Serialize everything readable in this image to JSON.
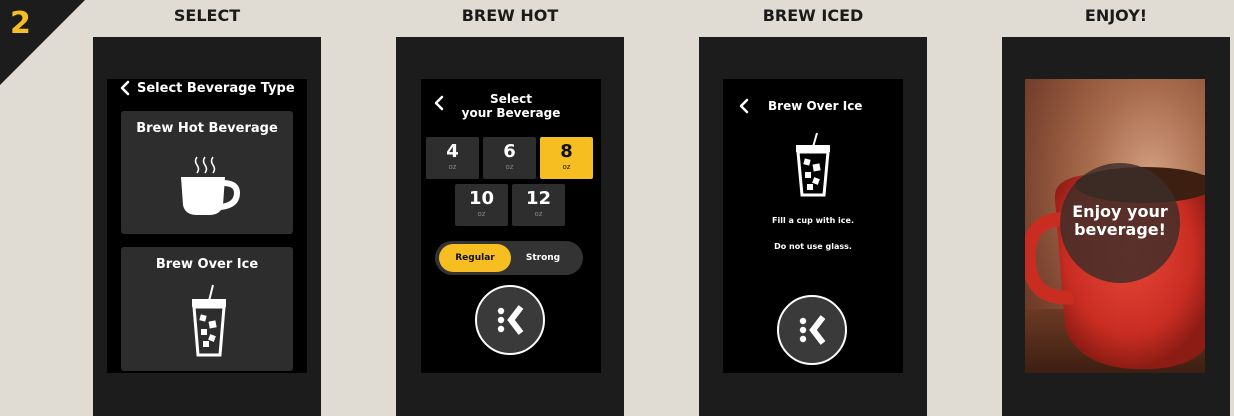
{
  "step": {
    "number": "2"
  },
  "columns": [
    {
      "title": "SELECT"
    },
    {
      "title": "BREW HOT"
    },
    {
      "title": "BREW ICED"
    },
    {
      "title": "ENJOY!"
    }
  ],
  "select": {
    "title": "Select Beverage Type",
    "back_icon": "chevron-left-icon",
    "options": [
      {
        "label": "Brew Hot Beverage",
        "icon": "hot-cup-icon"
      },
      {
        "label": "Brew Over Ice",
        "icon": "iced-cup-icon"
      }
    ]
  },
  "brew_hot": {
    "title_line1": "Select",
    "title_line2": "your Beverage",
    "sizes": [
      {
        "value": "4",
        "unit": "oz",
        "selected": false
      },
      {
        "value": "6",
        "unit": "oz",
        "selected": false
      },
      {
        "value": "8",
        "unit": "oz",
        "selected": true
      },
      {
        "value": "10",
        "unit": "oz",
        "selected": false
      },
      {
        "value": "12",
        "unit": "oz",
        "selected": false
      }
    ],
    "strength": {
      "regular": "Regular",
      "strong": "Strong",
      "selected": "Regular"
    },
    "brew_icon": "keurig-k-icon"
  },
  "brew_iced": {
    "title": "Brew Over Ice",
    "instruction1": "Fill a cup with ice.",
    "instruction2": "Do not use glass.",
    "brew_icon": "keurig-k-icon"
  },
  "enjoy": {
    "line1": "Enjoy your",
    "line2": "beverage!"
  },
  "colors": {
    "accent": "#f6be20",
    "background": "#e0dbd3",
    "device": "#1c1c1c",
    "screen": "#000000"
  }
}
